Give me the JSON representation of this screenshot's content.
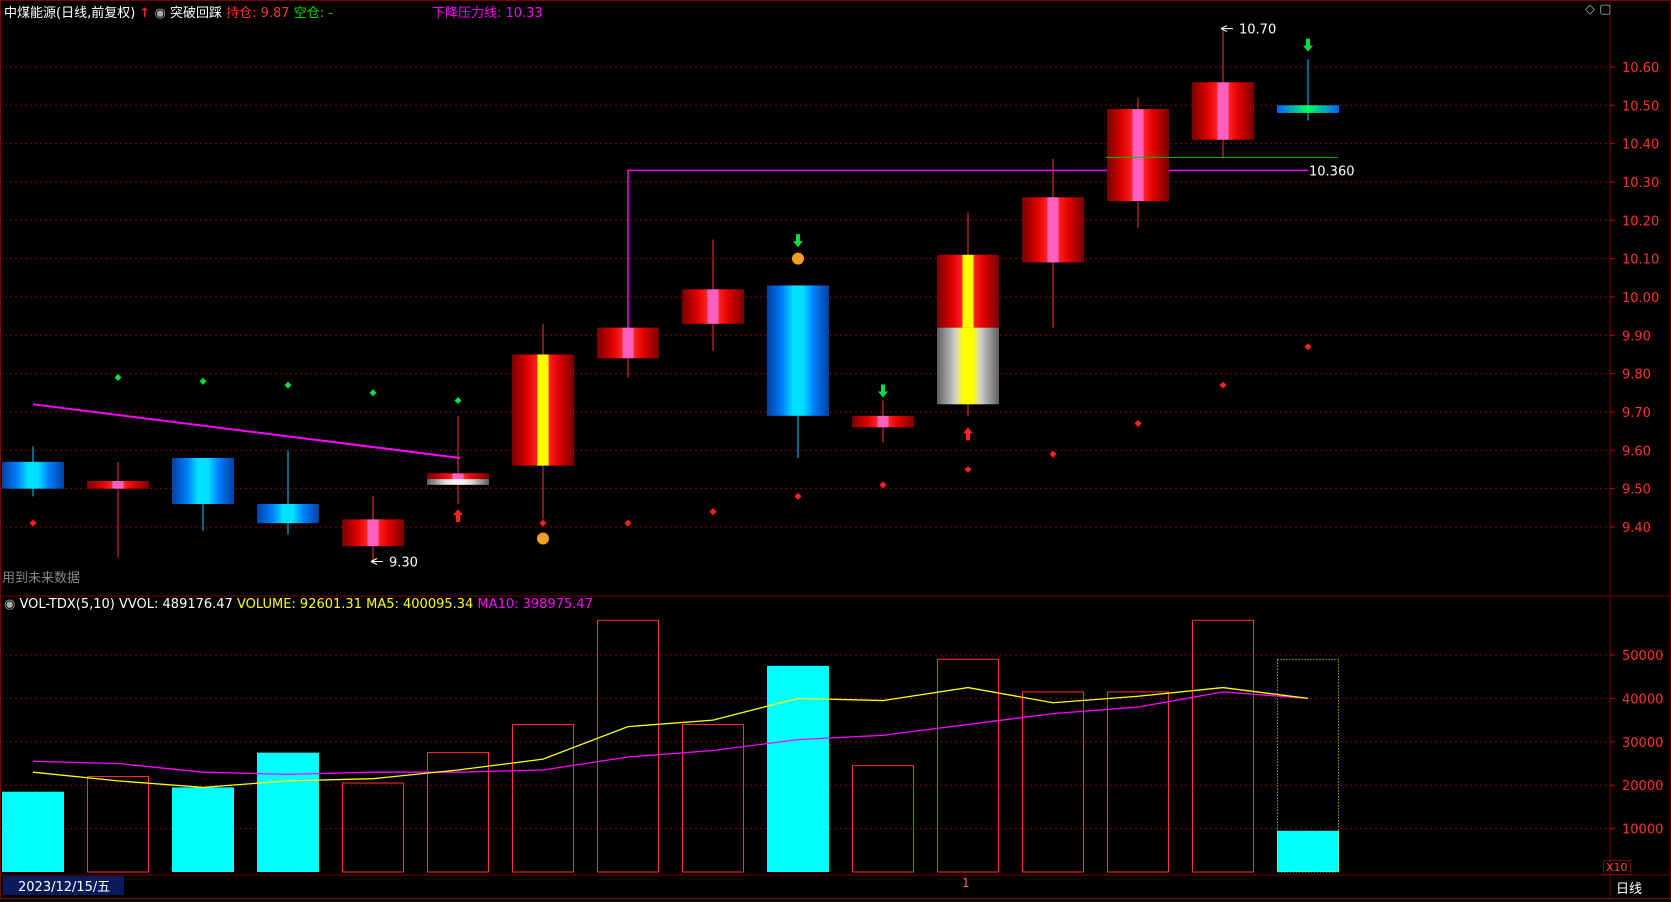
{
  "header": {
    "stock_title": "中煤能源(日线,前复权)",
    "signal_name": "突破回踩",
    "hold_text": "持仓: 9.87",
    "short_text": "空仓: -",
    "pressure_label": "下降压力线: 10.33",
    "future_data_text": "用到未来数据"
  },
  "vol_header": {
    "name": "VOL-TDX(5,10)",
    "vvol": "VVOL: 489176.47",
    "volume": "VOLUME: 92601.31",
    "ma5": "MA5: 400095.34",
    "ma10": "MA10: 398975.47"
  },
  "footer": {
    "date": "2023/12/15/五",
    "period": "日线",
    "marker": "1",
    "vol_unit": "X10"
  },
  "colors": {
    "up": "#ff0000",
    "down": "#00c8ff",
    "volume_down": "#00ffff",
    "ma5": "#ffff00",
    "ma10": "#ff00ff",
    "pressure_line": "#ff00ff",
    "grid": "#8b0000"
  },
  "chart_data": {
    "type": "candlestick",
    "price_axis": {
      "min": 9.4,
      "max": 10.6,
      "ticks": [
        "10.60",
        "10.50",
        "10.40",
        "10.30",
        "10.20",
        "10.10",
        "10.00",
        "9.90",
        "9.80",
        "9.70",
        "9.60",
        "9.50",
        "9.40"
      ]
    },
    "volume_axis": {
      "ticks": [
        "50000",
        "40000",
        "30000",
        "20000",
        "10000"
      ],
      "unit": "X10"
    },
    "candles": [
      {
        "o": 9.57,
        "h": 9.61,
        "l": 9.48,
        "c": 9.5,
        "vol": 18500,
        "dot": 9.41,
        "dotc": "red"
      },
      {
        "o": 9.5,
        "h": 9.57,
        "l": 9.32,
        "c": 9.52,
        "vol": 22000,
        "dot": 9.79,
        "dotc": "green"
      },
      {
        "o": 9.58,
        "h": 9.58,
        "l": 9.39,
        "c": 9.46,
        "vol": 19500,
        "dot": 9.78,
        "dotc": "green"
      },
      {
        "o": 9.46,
        "h": 9.6,
        "l": 9.38,
        "c": 9.41,
        "vol": 27500,
        "dot": 9.77,
        "dotc": "green"
      },
      {
        "o": 9.35,
        "h": 9.48,
        "l": 9.31,
        "c": 9.42,
        "vol": 20500,
        "dot": 9.75,
        "dotc": "green"
      },
      {
        "o": 9.51,
        "h": 9.69,
        "l": 9.46,
        "c": 9.54,
        "vol": 27500,
        "dot": 9.73,
        "dotc": "green",
        "neutral": true
      },
      {
        "o": 9.56,
        "h": 9.93,
        "l": 9.42,
        "c": 9.85,
        "vol": 34000,
        "dot": 9.41,
        "dotc": "red"
      },
      {
        "o": 9.84,
        "h": 9.92,
        "l": 9.79,
        "c": 9.92,
        "vol": 58000,
        "dot": 9.41,
        "dotc": "red"
      },
      {
        "o": 9.93,
        "h": 10.15,
        "l": 9.86,
        "c": 10.02,
        "vol": 34000,
        "dot": 9.44,
        "dotc": "red"
      },
      {
        "o": 10.03,
        "h": 10.03,
        "l": 9.58,
        "c": 9.69,
        "vol": 47500,
        "dot": 9.48,
        "dotc": "red"
      },
      {
        "o": 9.66,
        "h": 9.73,
        "l": 9.62,
        "c": 9.69,
        "vol": 24500,
        "dot": 9.51,
        "dotc": "red"
      },
      {
        "o": 9.72,
        "h": 10.22,
        "l": 9.69,
        "c": 10.11,
        "vol": 49000,
        "dot": 9.55,
        "dotc": "red",
        "split": 9.92
      },
      {
        "o": 10.09,
        "h": 10.36,
        "l": 9.92,
        "c": 10.26,
        "vol": 41500,
        "dot": 9.59,
        "dotc": "red"
      },
      {
        "o": 10.25,
        "h": 10.52,
        "l": 10.18,
        "c": 10.49,
        "vol": 41500,
        "dot": 9.67,
        "dotc": "red"
      },
      {
        "o": 10.41,
        "h": 10.7,
        "l": 10.36,
        "c": 10.56,
        "vol": 58000,
        "dot": 9.77,
        "dotc": "red"
      },
      {
        "o": 10.5,
        "h": 10.62,
        "l": 10.46,
        "c": 10.48,
        "vol": 9500,
        "dot": 9.87,
        "dotc": "red",
        "last": true,
        "vol_outline": 49000
      }
    ],
    "ma5": [
      23000,
      21000,
      19500,
      21000,
      21500,
      23500,
      26000,
      33500,
      35000,
      40000,
      39500,
      42500,
      39000,
      40500,
      42500,
      40000
    ],
    "ma10": [
      25500,
      25000,
      23000,
      22500,
      23000,
      23000,
      23500,
      26500,
      28000,
      30500,
      31500,
      34000,
      36500,
      38000,
      41500,
      40000
    ],
    "pressure_line_down": {
      "from": {
        "i": 0,
        "price": 9.72
      },
      "to": {
        "i": 5,
        "price": 9.58
      }
    },
    "pressure_line_flat": {
      "from_i": 7,
      "to_i": 15,
      "price": 10.33
    },
    "annotations": {
      "low_label": "9.30",
      "high_label": "10.70",
      "level_label": "10.360"
    }
  }
}
